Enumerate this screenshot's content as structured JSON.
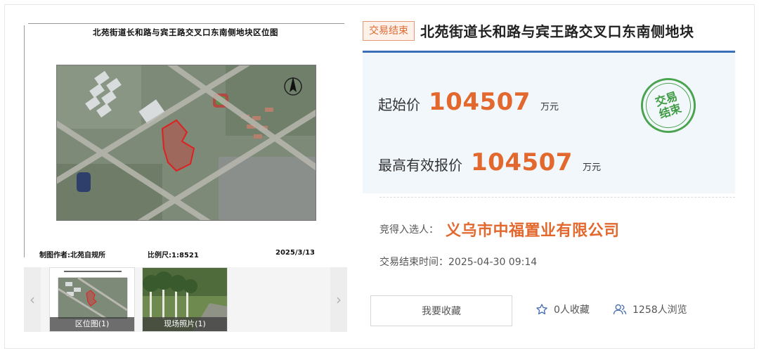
{
  "document": {
    "title": "北苑街道长和路与宾王路交叉口东南侧地块区位图",
    "author": "制图作者:北苑自规所",
    "scale": "比例尺:1:8521",
    "date": "2025/3/13"
  },
  "thumbnails": [
    {
      "caption": "区位图(1)"
    },
    {
      "caption": "现场照片(1)"
    }
  ],
  "listing": {
    "status": "交易结束",
    "title": "北苑街道长和路与宾王路交叉口东南侧地块",
    "starting_price_label": "起始价",
    "starting_price": "104507",
    "starting_price_unit": "万元",
    "highest_bid_label": "最高有效报价",
    "highest_bid": "104507",
    "highest_bid_unit": "万元",
    "stamp_line1": "交易",
    "stamp_line2": "结束",
    "winner_label": "竞得入选人：",
    "winner": "义乌市中福置业有限公司",
    "end_time_label": "交易结束时间：",
    "end_time": "2025-04-30 09:14"
  },
  "actions": {
    "favorite_button": "我要收藏",
    "favorites_count": "0人收藏",
    "views_count": "1258人浏览"
  },
  "colors": {
    "accent": "#e2682e",
    "rule": "#3b6fb8",
    "stamp": "#4aa34e"
  }
}
